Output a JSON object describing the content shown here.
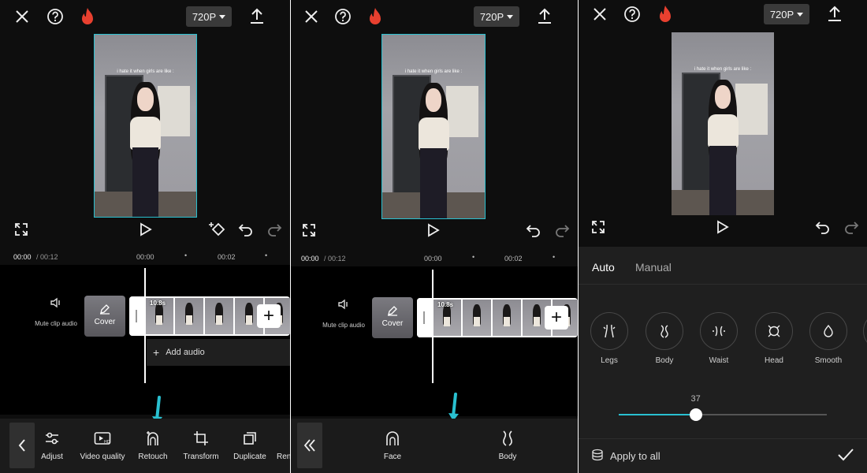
{
  "resolution_label": "720P",
  "video_caption": "i hate it when girls are like :",
  "panel1": {
    "timecode_current": "00:00",
    "timecode_total": "/ 00:12",
    "ruler": [
      "00:00",
      "00:02"
    ],
    "mute_label": "Mute clip audio",
    "cover_label": "Cover",
    "clip_duration": "10.8s",
    "add_audio_label": "Add audio",
    "tools": [
      "Adjust",
      "Video quality",
      "Retouch",
      "Transform",
      "Duplicate",
      "Ren"
    ]
  },
  "panel2": {
    "timecode_current": "00:00",
    "timecode_total": "/ 00:12",
    "ruler": [
      "00:00",
      "00:02"
    ],
    "mute_label": "Mute clip audio",
    "cover_label": "Cover",
    "clip_duration": "10.8s",
    "tools": [
      "Face",
      "Body"
    ]
  },
  "panel3": {
    "tabs": [
      "Auto",
      "Manual"
    ],
    "options": [
      "Legs",
      "Body",
      "Waist",
      "Head",
      "Smooth"
    ],
    "slider_value": "37",
    "slider_fraction": 0.37,
    "apply_all_label": "Apply to all"
  },
  "colors": {
    "accent": "#29c0d0",
    "flame": "#e8402f"
  },
  "icons": [
    "close-icon",
    "help-icon",
    "flame-icon",
    "export-icon",
    "fullscreen-icon",
    "play-icon",
    "keyframe-icon",
    "undo-icon",
    "redo-icon",
    "speaker-icon",
    "pencil-icon",
    "plus-icon",
    "chevron-left-icon",
    "double-chevron-left-icon",
    "checkmark-icon",
    "layers-icon"
  ]
}
